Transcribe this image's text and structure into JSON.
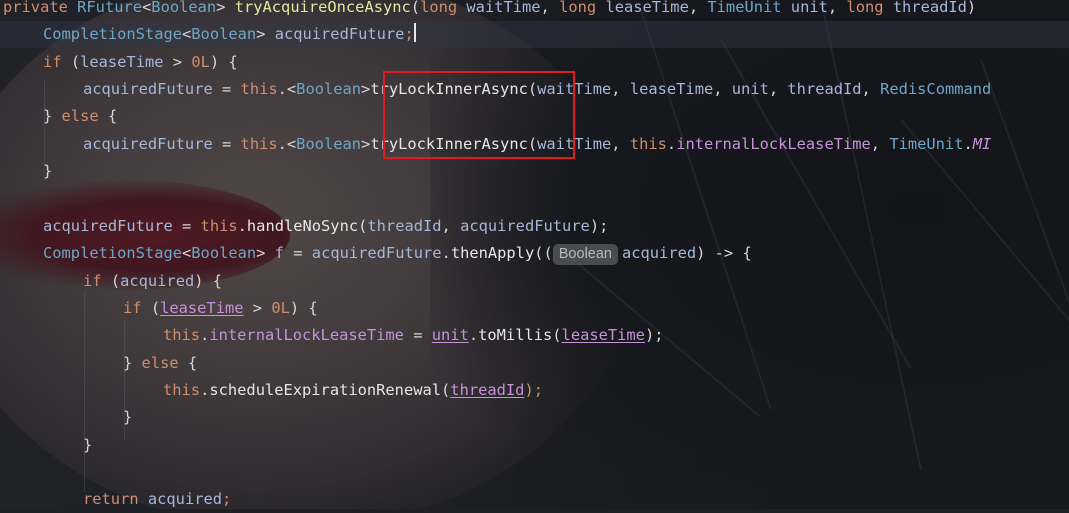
{
  "editor": {
    "language": "Java",
    "lines": [
      {
        "indent": 0,
        "tokens": [
          {
            "t": "private ",
            "c": "kw"
          },
          {
            "t": "RFuture",
            "c": "ty"
          },
          {
            "t": "<",
            "c": "pl"
          },
          {
            "t": "Boolean",
            "c": "ty"
          },
          {
            "t": "> ",
            "c": "pl"
          },
          {
            "t": "tryAcquireOnceAsync",
            "c": "fn"
          },
          {
            "t": "(",
            "c": "pl"
          },
          {
            "t": "long ",
            "c": "kw"
          },
          {
            "t": "waitTime",
            "c": "vr"
          },
          {
            "t": ", ",
            "c": "pl"
          },
          {
            "t": "long ",
            "c": "kw"
          },
          {
            "t": "leaseTime",
            "c": "vr"
          },
          {
            "t": ", ",
            "c": "pl"
          },
          {
            "t": "TimeUnit ",
            "c": "ty"
          },
          {
            "t": "unit",
            "c": "vr"
          },
          {
            "t": ", ",
            "c": "pl"
          },
          {
            "t": "long ",
            "c": "kw"
          },
          {
            "t": "threadId",
            "c": "vr"
          },
          {
            "t": ")",
            "c": "pl"
          }
        ]
      },
      {
        "indent": 1,
        "current": true,
        "tokens": [
          {
            "t": "CompletionStage",
            "c": "ty"
          },
          {
            "t": "<",
            "c": "pl"
          },
          {
            "t": "Boolean",
            "c": "ty"
          },
          {
            "t": "> ",
            "c": "pl"
          },
          {
            "t": "acquiredFuture",
            "c": "vr"
          },
          {
            "t": ";",
            "c": "kw"
          },
          {
            "t": "|",
            "c": "caret"
          }
        ]
      },
      {
        "indent": 1,
        "tokens": [
          {
            "t": "if ",
            "c": "kw"
          },
          {
            "t": "(",
            "c": "pl"
          },
          {
            "t": "leaseTime",
            "c": "vr"
          },
          {
            "t": " > ",
            "c": "pl"
          },
          {
            "t": "0L",
            "c": "num"
          },
          {
            "t": ") {",
            "c": "pl"
          }
        ]
      },
      {
        "indent": 2,
        "tokens": [
          {
            "t": "acquiredFuture",
            "c": "vr"
          },
          {
            "t": " = ",
            "c": "pl"
          },
          {
            "t": "this",
            "c": "kw"
          },
          {
            "t": ".<",
            "c": "pl"
          },
          {
            "t": "Boolean",
            "c": "ty"
          },
          {
            "t": ">",
            "c": "pl"
          },
          {
            "t": "tryLockInnerAsync",
            "c": "mt"
          },
          {
            "t": "(",
            "c": "pl"
          },
          {
            "t": "waitTime",
            "c": "vr"
          },
          {
            "t": ", ",
            "c": "pl"
          },
          {
            "t": "leaseTime",
            "c": "vr"
          },
          {
            "t": ", ",
            "c": "pl"
          },
          {
            "t": "unit",
            "c": "vr"
          },
          {
            "t": ", ",
            "c": "pl"
          },
          {
            "t": "threadId",
            "c": "vr"
          },
          {
            "t": ", ",
            "c": "pl"
          },
          {
            "t": "RedisCommand",
            "c": "ty"
          }
        ]
      },
      {
        "indent": 1,
        "tokens": [
          {
            "t": "} ",
            "c": "pl"
          },
          {
            "t": "else ",
            "c": "kw"
          },
          {
            "t": "{",
            "c": "pl"
          }
        ]
      },
      {
        "indent": 2,
        "tokens": [
          {
            "t": "acquiredFuture",
            "c": "vr"
          },
          {
            "t": " = ",
            "c": "pl"
          },
          {
            "t": "this",
            "c": "kw"
          },
          {
            "t": ".<",
            "c": "pl"
          },
          {
            "t": "Boolean",
            "c": "ty"
          },
          {
            "t": ">",
            "c": "pl"
          },
          {
            "t": "tryLockInnerAsync",
            "c": "mt"
          },
          {
            "t": "(",
            "c": "pl"
          },
          {
            "t": "waitTime",
            "c": "vr"
          },
          {
            "t": ", ",
            "c": "pl"
          },
          {
            "t": "this",
            "c": "kw"
          },
          {
            "t": ".",
            "c": "pl"
          },
          {
            "t": "internalLockLeaseTime",
            "c": "fld"
          },
          {
            "t": ", ",
            "c": "pl"
          },
          {
            "t": "TimeUnit",
            "c": "ty"
          },
          {
            "t": ".",
            "c": "pl"
          },
          {
            "t": "MI",
            "c": "mi"
          }
        ]
      },
      {
        "indent": 1,
        "tokens": [
          {
            "t": "}",
            "c": "pl"
          }
        ]
      },
      {
        "indent": 0,
        "tokens": []
      },
      {
        "indent": 1,
        "tokens": [
          {
            "t": "acquiredFuture",
            "c": "vr"
          },
          {
            "t": " = ",
            "c": "pl"
          },
          {
            "t": "this",
            "c": "kw"
          },
          {
            "t": ".",
            "c": "pl"
          },
          {
            "t": "handleNoSync",
            "c": "mt"
          },
          {
            "t": "(",
            "c": "pl"
          },
          {
            "t": "threadId",
            "c": "vr"
          },
          {
            "t": ", ",
            "c": "pl"
          },
          {
            "t": "acquiredFuture",
            "c": "vr"
          },
          {
            "t": ");",
            "c": "pl"
          }
        ]
      },
      {
        "indent": 1,
        "tokens": [
          {
            "t": "CompletionStage",
            "c": "ty"
          },
          {
            "t": "<",
            "c": "pl"
          },
          {
            "t": "Boolean",
            "c": "ty"
          },
          {
            "t": "> ",
            "c": "pl"
          },
          {
            "t": "f",
            "c": "vr"
          },
          {
            "t": " = ",
            "c": "pl"
          },
          {
            "t": "acquiredFuture",
            "c": "vr"
          },
          {
            "t": ".",
            "c": "pl"
          },
          {
            "t": "thenApply",
            "c": "mt"
          },
          {
            "t": "((",
            "c": "pl"
          },
          {
            "t": "Boolean",
            "c": "hint"
          },
          {
            "t": "acquired",
            "c": "vr"
          },
          {
            "t": ") -> {",
            "c": "pl"
          }
        ]
      },
      {
        "indent": 2,
        "tokens": [
          {
            "t": "if ",
            "c": "kw"
          },
          {
            "t": "(",
            "c": "pl"
          },
          {
            "t": "acquired",
            "c": "vr"
          },
          {
            "t": ") {",
            "c": "pl"
          }
        ]
      },
      {
        "indent": 3,
        "tokens": [
          {
            "t": "if ",
            "c": "kw"
          },
          {
            "t": "(",
            "c": "pl"
          },
          {
            "t": "leaseTime",
            "c": "pm"
          },
          {
            "t": " > ",
            "c": "pl"
          },
          {
            "t": "0L",
            "c": "num"
          },
          {
            "t": ") {",
            "c": "pl"
          }
        ]
      },
      {
        "indent": 4,
        "tokens": [
          {
            "t": "this",
            "c": "kw"
          },
          {
            "t": ".",
            "c": "pl"
          },
          {
            "t": "internalLockLeaseTime",
            "c": "fld"
          },
          {
            "t": " = ",
            "c": "pl"
          },
          {
            "t": "unit",
            "c": "pm"
          },
          {
            "t": ".",
            "c": "pl"
          },
          {
            "t": "toMillis",
            "c": "mt"
          },
          {
            "t": "(",
            "c": "pl"
          },
          {
            "t": "leaseTime",
            "c": "pm"
          },
          {
            "t": ");",
            "c": "pl"
          }
        ]
      },
      {
        "indent": 3,
        "tokens": [
          {
            "t": "} ",
            "c": "pl"
          },
          {
            "t": "else ",
            "c": "kw"
          },
          {
            "t": "{",
            "c": "pl"
          }
        ]
      },
      {
        "indent": 4,
        "tokens": [
          {
            "t": "this",
            "c": "kw"
          },
          {
            "t": ".",
            "c": "pl"
          },
          {
            "t": "scheduleExpirationRenewal",
            "c": "mt"
          },
          {
            "t": "(",
            "c": "pl"
          },
          {
            "t": "threadId",
            "c": "pm"
          },
          {
            "t": ");",
            "c": "kw"
          }
        ]
      },
      {
        "indent": 3,
        "tokens": [
          {
            "t": "}",
            "c": "pl"
          }
        ]
      },
      {
        "indent": 2,
        "tokens": [
          {
            "t": "}",
            "c": "pl"
          }
        ]
      },
      {
        "indent": 0,
        "tokens": []
      },
      {
        "indent": 2,
        "tokens": [
          {
            "t": "return ",
            "c": "kw"
          },
          {
            "t": "acquired",
            "c": "vr"
          },
          {
            "t": ";",
            "c": "kw"
          }
        ]
      }
    ]
  },
  "highlight": {
    "label": "tryLockInnerAsync",
    "color": "#e01b24"
  }
}
